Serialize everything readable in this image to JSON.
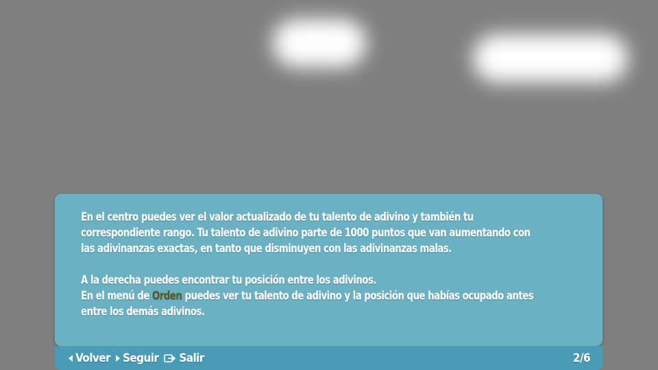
{
  "tutorial": {
    "paragraph1": "En el centro puedes ver el valor actualizado de tu talento de adivino y también tu correspondiente rango. Tu talento de adivino parte de 1000 puntos que van aumentando con las adivinanzas exactas, en tanto que disminuyen con las adivinanzas malas.",
    "paragraph2_line1": "A la derecha puedes encontrar tu posición entre los adivinos.",
    "paragraph2_line2_pre": "En el menú de ",
    "paragraph2_line2_highlight": "Orden",
    "paragraph2_line2_post": " puedes ver tu talento de adivino y la posición que habías ocupado antes entre los demás adivinos.",
    "highlight_color": "#5a5a22"
  },
  "footer": {
    "back_label": "Volver",
    "next_label": "Seguir",
    "exit_label": "Salir",
    "page_indicator": "2/6"
  },
  "colors": {
    "background": "#7f7f7f",
    "panel": "#6ab2c3",
    "footer": "#4a9cb6",
    "text": "#ffffff"
  },
  "icons": {
    "back": "triangle-left-icon",
    "next": "triangle-right-icon",
    "exit": "exit-icon"
  }
}
